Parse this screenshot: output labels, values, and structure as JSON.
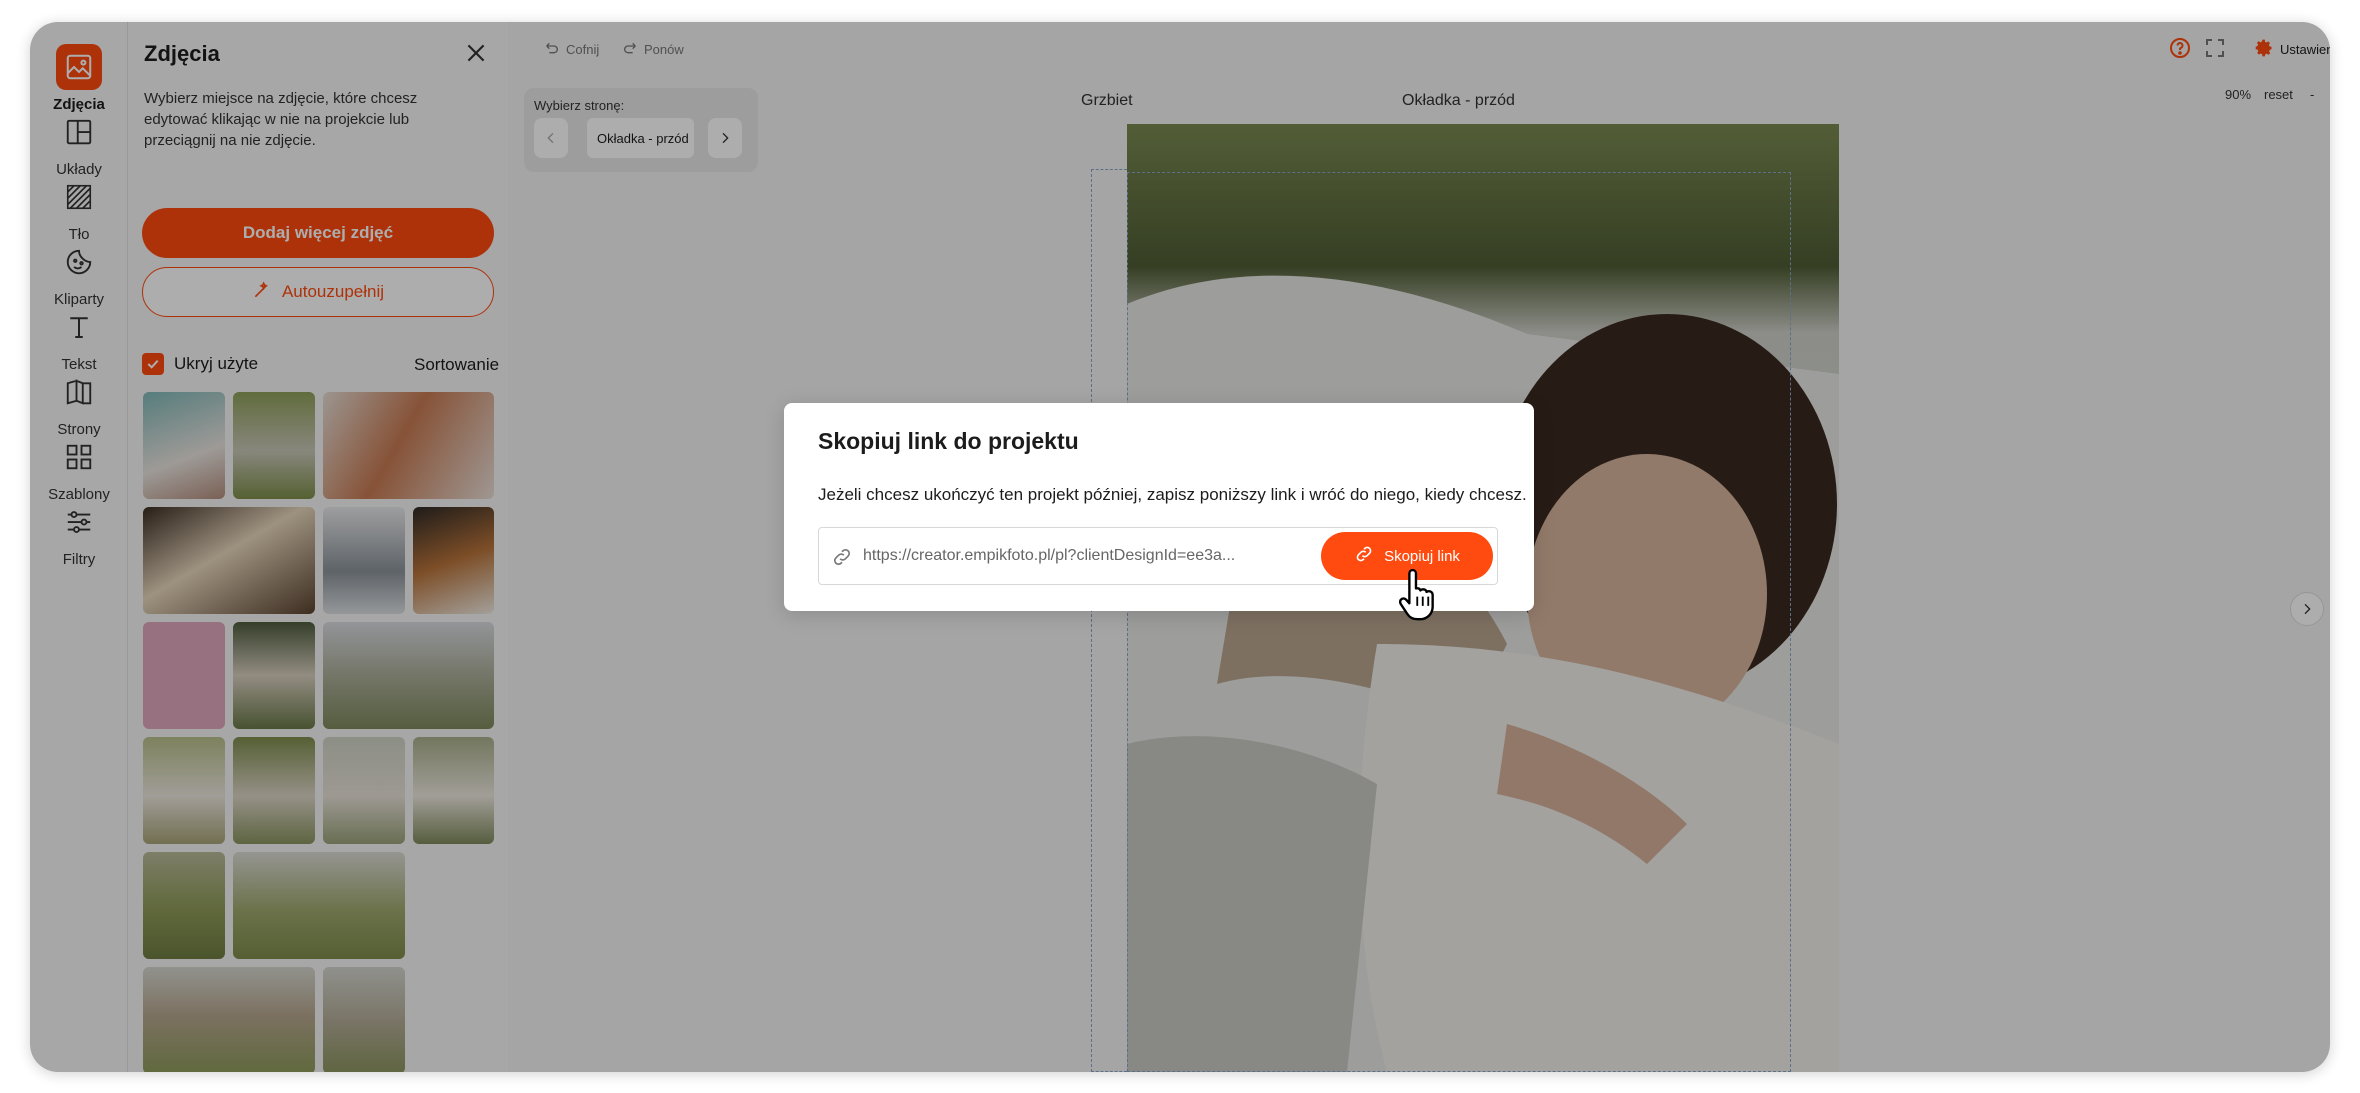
{
  "sidebar": {
    "items": [
      {
        "label": "Zdjęcia",
        "icon": "image-icon",
        "active": true
      },
      {
        "label": "Układy",
        "icon": "layout-icon"
      },
      {
        "label": "Tło",
        "icon": "background-icon"
      },
      {
        "label": "Kliparty",
        "icon": "sticker-icon"
      },
      {
        "label": "Tekst",
        "icon": "text-icon"
      },
      {
        "label": "Strony",
        "icon": "book-pages-icon"
      },
      {
        "label": "Szablony",
        "icon": "templates-icon"
      },
      {
        "label": "Filtry",
        "icon": "filters-icon"
      }
    ]
  },
  "panel": {
    "title": "Zdjęcia",
    "hint": "Wybierz miejsce na zdjęcie, które chcesz edytować klikając w nie na projekcie lub przeciągnij na nie zdjęcie.",
    "add_button": "Dodaj więcej zdjęć",
    "autofill_button": "Autouzupełnij",
    "hide_used_label": "Ukryj użyte",
    "hide_used_checked": true,
    "sort_label": "Sortowanie"
  },
  "toolbar": {
    "undo": "Cofnij",
    "redo": "Ponów",
    "settings": "Ustawienia"
  },
  "page_picker": {
    "label": "Wybierz stronę:",
    "value": "Okładka - przód"
  },
  "canvas": {
    "spine_label": "Grzbiet",
    "front_label": "Okładka - przód",
    "zoom": "90%",
    "reset": "reset",
    "zoom_out": "-",
    "zoom_in": "+"
  },
  "modal": {
    "title": "Skopiuj link do projektu",
    "text": "Jeżeli chcesz ukończyć ten projekt później, zapisz poniższy link i wróć do niego, kiedy chcesz.",
    "link_value": "https://creator.empikfoto.pl/pl?clientDesignId=ee3a...",
    "copy_button": "Skopiuj link"
  },
  "colors": {
    "accent": "#ff4b10",
    "overlay": "rgba(0,0,0,0.32)"
  }
}
